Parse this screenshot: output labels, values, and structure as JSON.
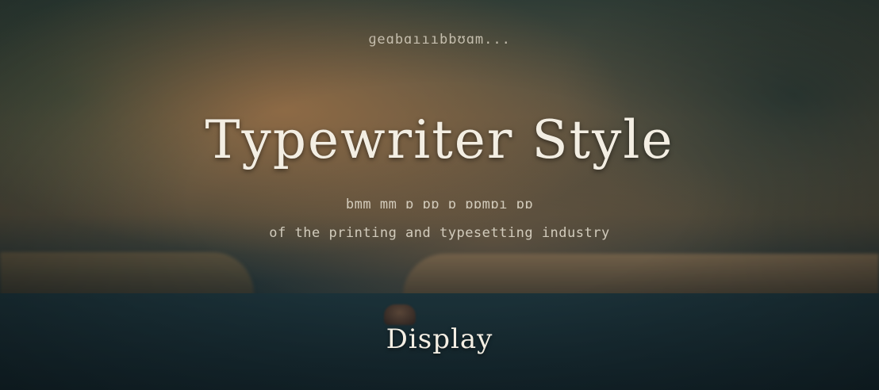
{
  "banner": {
    "caption": "ɡeɑbɑıııbbʊɑm...",
    "title": "Typewriter Style",
    "description_line1": "bmm mm ɒ ɒɒ ɒ ɒɒmɒı ɒɒ",
    "description_line2": "of the printing and typesetting industry",
    "category": "Display"
  }
}
